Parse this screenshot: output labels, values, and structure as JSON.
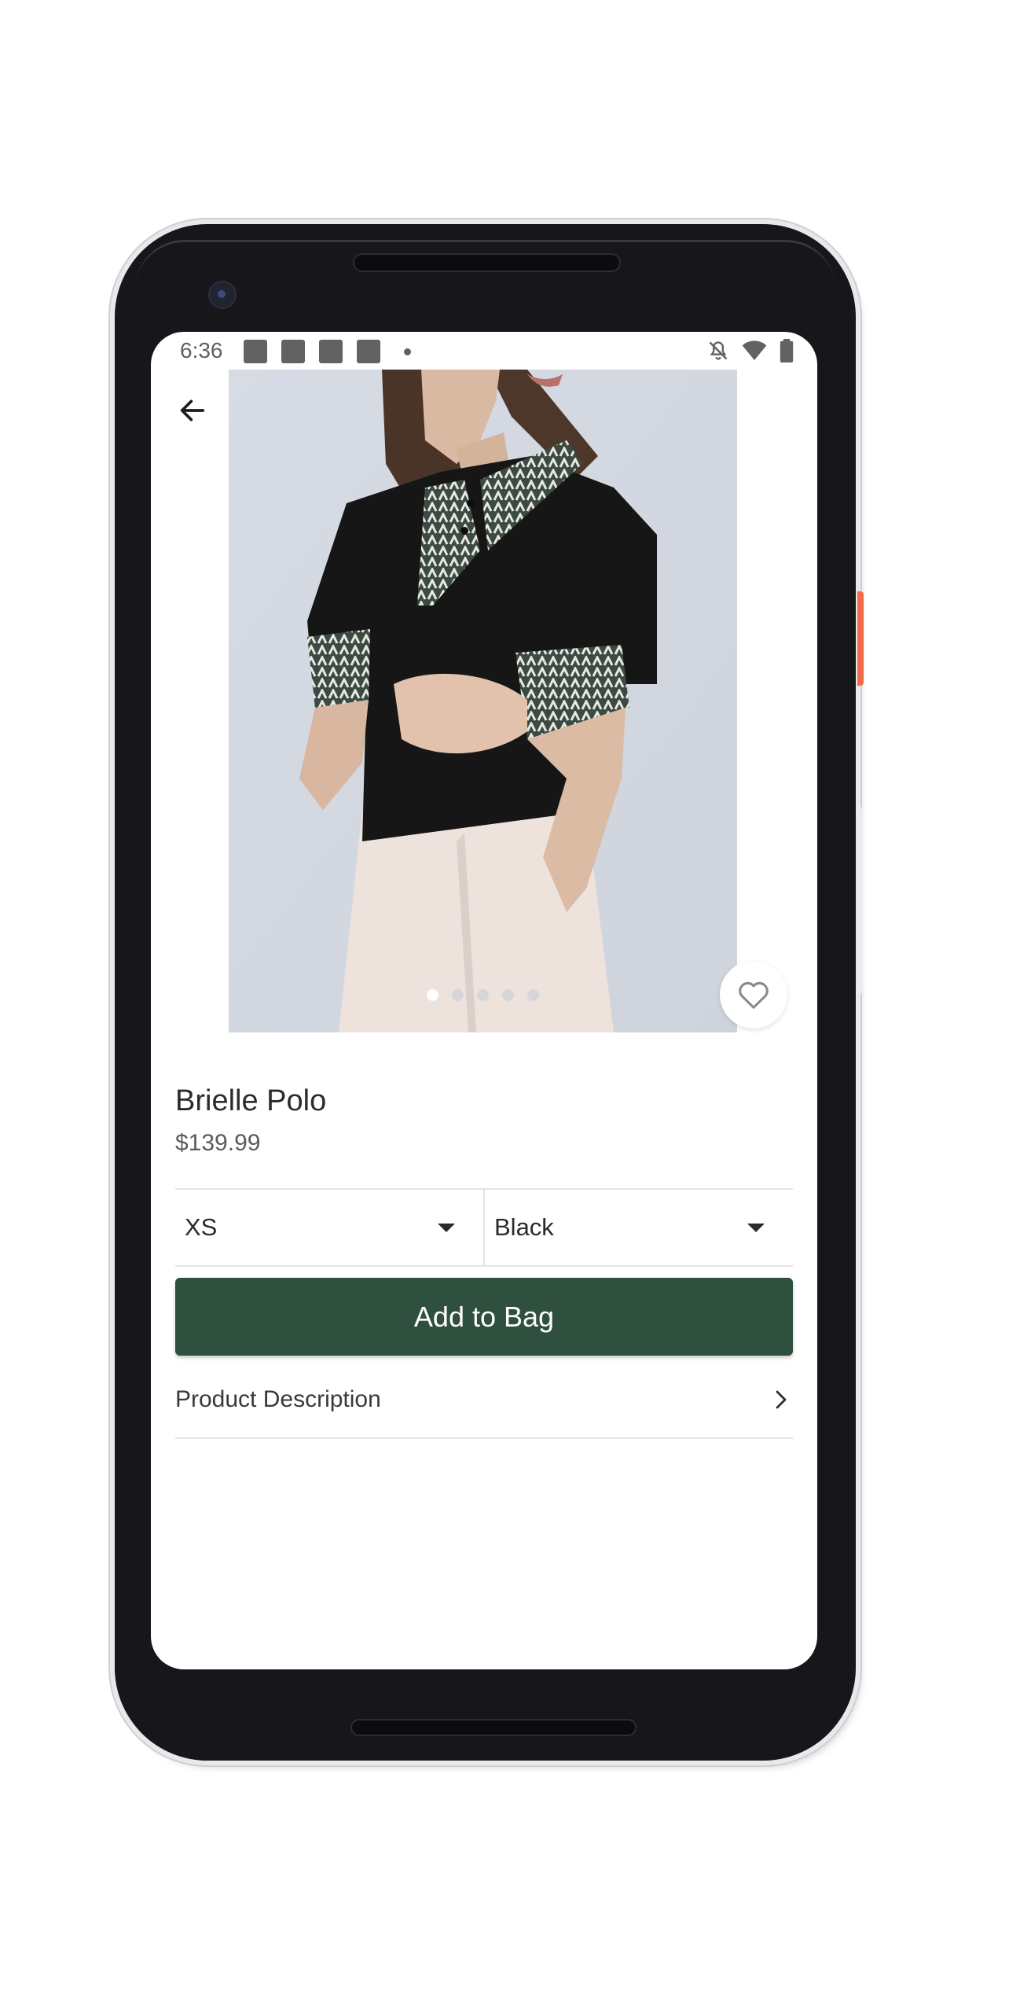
{
  "status_bar": {
    "time": "6:36",
    "notification_icons": [
      "notification-icon",
      "notification-icon",
      "notification-icon",
      "notification-icon"
    ],
    "right_icons": [
      "bell-off-icon",
      "wifi-icon",
      "battery-icon"
    ]
  },
  "product": {
    "name": "Brielle Polo",
    "price": "$139.99",
    "image_count": 5,
    "active_image_index": 0
  },
  "selectors": {
    "size": "XS",
    "color": "Black"
  },
  "actions": {
    "add_to_bag": "Add to Bag"
  },
  "sections": {
    "description_label": "Product Description"
  },
  "colors": {
    "accent": "#2f4f3f",
    "text": "#2b2b2b",
    "divider": "#e4e4e4"
  }
}
